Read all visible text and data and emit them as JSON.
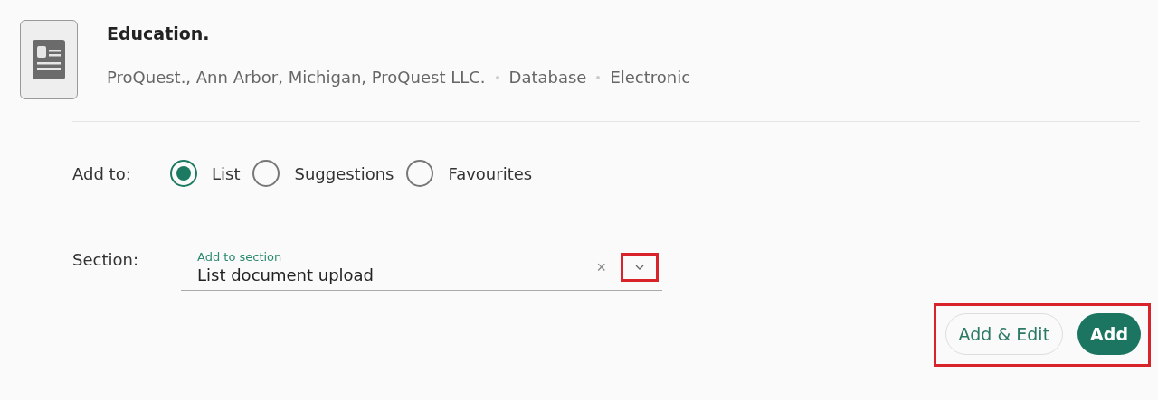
{
  "item": {
    "title": "Education.",
    "meta": [
      "ProQuest., Ann Arbor, Michigan, ProQuest LLC.",
      "Database",
      "Electronic"
    ]
  },
  "add_to": {
    "label": "Add to:",
    "options": [
      {
        "label": "List",
        "selected": true
      },
      {
        "label": "Suggestions",
        "selected": false
      },
      {
        "label": "Favourites",
        "selected": false
      }
    ]
  },
  "section": {
    "label": "Section:",
    "field_label": "Add to section",
    "value": "List document upload",
    "clear": "×",
    "dropdown_highlighted": true
  },
  "actions": {
    "highlighted": true,
    "buttons": [
      {
        "label": "Add & Edit",
        "kind": "outline"
      },
      {
        "label": "Add",
        "kind": "primary"
      }
    ]
  }
}
